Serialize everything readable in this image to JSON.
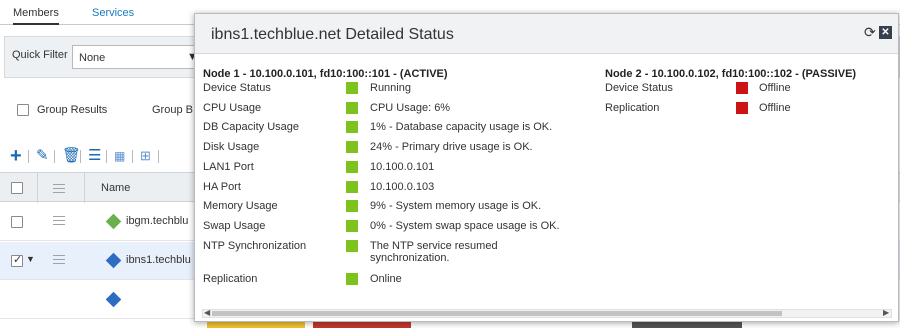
{
  "tabs": {
    "members": "Members",
    "services": "Services"
  },
  "filter": {
    "label": "Quick Filter",
    "value": "None"
  },
  "grouping": {
    "group_results": "Group Results",
    "group_by": "Group B"
  },
  "grid": {
    "name_header": "Name",
    "rows": [
      {
        "name": "ibgm.techblu",
        "selected": false,
        "icon_color": "#6ab04c"
      },
      {
        "name": "ibns1.techblu",
        "selected": true,
        "icon_color": "#2d6cc0"
      },
      {
        "name": "",
        "selected": false,
        "icon_color": "#2d6cc0"
      }
    ]
  },
  "popup": {
    "title": "ibns1.techblue.net Detailed Status",
    "node1": {
      "title": "Node 1 - 10.100.0.101, fd10:100::101 - (ACTIVE)",
      "rows": [
        {
          "label": "Device Status",
          "status": "green",
          "value": "Running"
        },
        {
          "label": "CPU Usage",
          "status": "green",
          "value": "CPU Usage: 6%"
        },
        {
          "label": "DB Capacity Usage",
          "status": "green",
          "value": "1% - Database capacity usage is OK."
        },
        {
          "label": "Disk Usage",
          "status": "green",
          "value": "24% - Primary drive usage is OK."
        },
        {
          "label": "LAN1 Port",
          "status": "green",
          "value": "10.100.0.101"
        },
        {
          "label": "HA Port",
          "status": "green",
          "value": "10.100.0.103"
        },
        {
          "label": "Memory Usage",
          "status": "green",
          "value": "9% - System memory usage is OK."
        },
        {
          "label": "Swap Usage",
          "status": "green",
          "value": "0% - System swap space usage is OK."
        },
        {
          "label": "NTP Synchronization",
          "status": "green",
          "value": "The NTP service resumed",
          "value2": "synchronization."
        },
        {
          "label": "Replication",
          "status": "green",
          "value": "Online"
        }
      ]
    },
    "node2": {
      "title": "Node 2 - 10.100.0.102, fd10:100::102 - (PASSIVE)",
      "rows": [
        {
          "label": "Device Status",
          "status": "red",
          "value": "Offline"
        },
        {
          "label": "Replication",
          "status": "red",
          "value": "Offline"
        }
      ]
    }
  },
  "colors": {
    "ok": "#7dc21e",
    "error": "#cc1414",
    "accent": "#1a7abf"
  }
}
